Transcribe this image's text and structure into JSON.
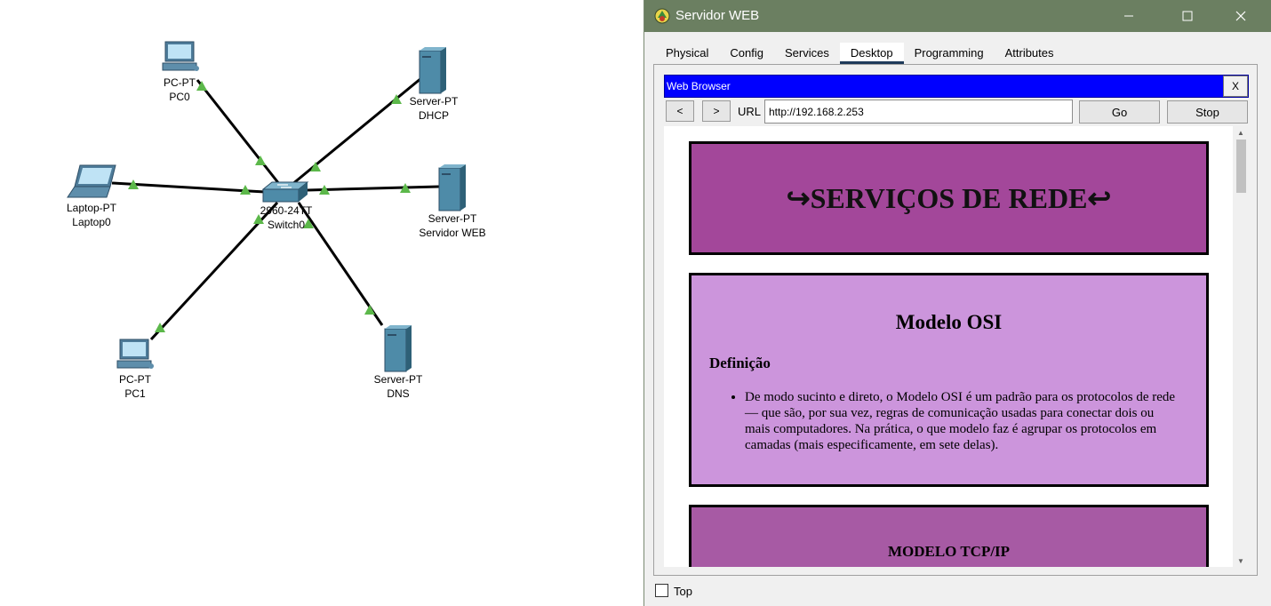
{
  "topology": {
    "nodes": [
      {
        "id": "pc0",
        "model": "PC-PT",
        "name": "PC0",
        "icon": "pc-icon"
      },
      {
        "id": "dhcp",
        "model": "Server-PT",
        "name": "DHCP",
        "icon": "server-icon"
      },
      {
        "id": "laptop0",
        "model": "Laptop-PT",
        "name": "Laptop0",
        "icon": "laptop-icon"
      },
      {
        "id": "switch0",
        "model": "2960-24TT",
        "name": "Switch0",
        "icon": "switch-icon"
      },
      {
        "id": "web",
        "model": "Server-PT",
        "name": "Servidor WEB",
        "icon": "server-icon"
      },
      {
        "id": "pc1",
        "model": "PC-PT",
        "name": "PC1",
        "icon": "pc-icon"
      },
      {
        "id": "dns",
        "model": "Server-PT",
        "name": "DNS",
        "icon": "server-icon"
      }
    ],
    "link_color": "#000000",
    "link_up_color": "#5cb84a"
  },
  "window": {
    "title": "Servidor WEB",
    "titlebar_color": "#6b7f61",
    "tabs": [
      {
        "label": "Physical"
      },
      {
        "label": "Config"
      },
      {
        "label": "Services"
      },
      {
        "label": "Desktop",
        "active": true
      },
      {
        "label": "Programming"
      },
      {
        "label": "Attributes"
      }
    ],
    "top_label": "Top"
  },
  "browser": {
    "title": "Web Browser",
    "close_label": "X",
    "back_label": "<",
    "forward_label": ">",
    "url_label": "URL",
    "url_value": "http://192.168.2.253",
    "go_label": "Go",
    "stop_label": "Stop"
  },
  "page": {
    "header_title": "↪SERVIÇOS DE REDE↩",
    "osi_title": "Modelo OSI",
    "osi_subtitle": "Definição",
    "osi_text": "De modo sucinto e direto, o Modelo OSI é um padrão para os protocolos de rede — que são, por sua vez, regras de comunicação usadas para conectar dois ou mais computadores. Na prática, o que modelo faz é agrupar os protocolos em camadas (mais especificamente, em sete delas).",
    "tcp_title": "MODELO TCP/IP",
    "colors": {
      "header": "#a3479a",
      "osi": "#cc95dc",
      "tcp": "#a75aa4"
    }
  }
}
